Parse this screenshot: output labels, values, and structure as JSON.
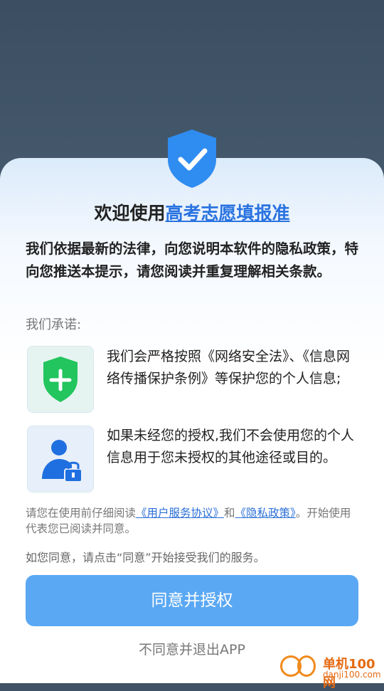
{
  "dialog": {
    "title_prefix": "欢迎使用",
    "app_name": "高考志愿填报准",
    "intro": "我们依据最新的法律，向您说明本软件的隐私政策，特向您推送本提示，请您阅读并重复理解相关条款。",
    "promise_label": "我们承诺:",
    "items": [
      {
        "icon": "green-shield-plus-icon",
        "text": "我们会严格按照《网络安全法》、《信息网络传播保护条例》等保护您的个人信息;"
      },
      {
        "icon": "user-lock-icon",
        "text": "如果未经您的授权,我们不会使用您的个人信息用于您未授权的其他途径或目的。"
      }
    ],
    "notice": {
      "before": "请您在使用前仔细阅读",
      "user_agreement": "《用户服务协议》",
      "and": "和",
      "privacy_policy": "《隐私政策》",
      "after": "。开始使用代表您已阅读并同意。"
    },
    "hint": "如您同意，请点击“同意”开始接受我们的服务。",
    "agree_label": "同意并授权",
    "reject_label": "不同意并退出APP"
  },
  "watermark": {
    "text1": "单机100网",
    "text2": "danji100.com"
  },
  "colors": {
    "accent": "#5aa8f4",
    "link": "#2a73e0",
    "shield_blue": "#2f8cf0",
    "shield_green": "#22c55e"
  }
}
